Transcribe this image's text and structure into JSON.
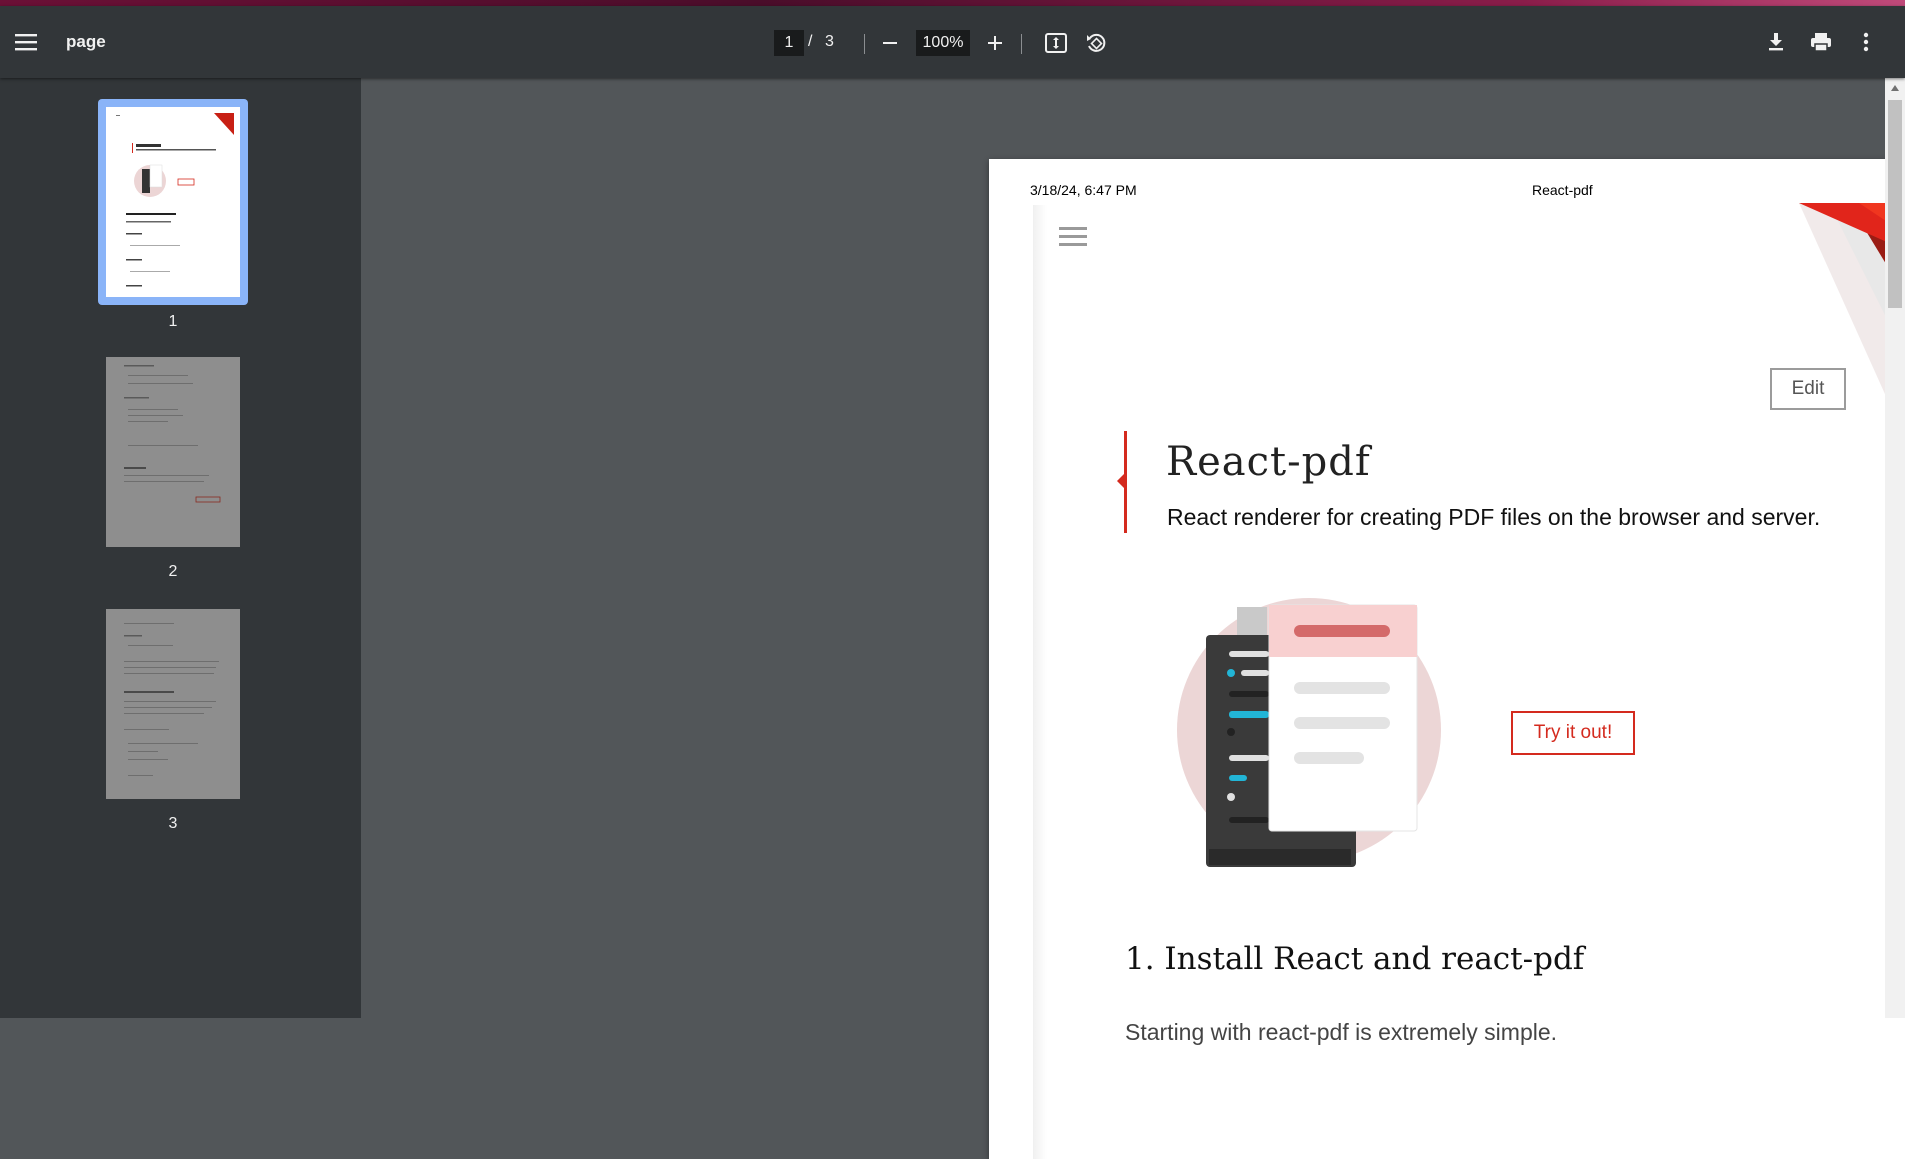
{
  "toolbar": {
    "menu_icon": "hamburger-menu-icon",
    "title": "page",
    "page_current": "1",
    "page_separator": "/",
    "page_total": "3",
    "zoom_value": "100%",
    "zoom_out_icon": "minus-icon",
    "zoom_in_icon": "plus-icon",
    "fit_page_icon": "fit-to-page-icon",
    "rotate_icon": "rotate-counterclockwise-icon",
    "download_icon": "download-icon",
    "print_icon": "print-icon",
    "more_icon": "more-vertical-icon"
  },
  "sidebar": {
    "thumbnails": [
      {
        "number": "1",
        "selected": true
      },
      {
        "number": "2",
        "selected": false
      },
      {
        "number": "3",
        "selected": false
      }
    ]
  },
  "page": {
    "header_date": "3/18/24, 6:47 PM",
    "header_title": "React-pdf",
    "edit_label": "Edit",
    "title": "React-pdf",
    "subtitle": "React renderer for creating PDF files on the browser and server.",
    "try_label": "Try it out!",
    "section_heading": "1. Install React and react-pdf",
    "section_text": "Starting with react-pdf is extremely simple."
  },
  "colors": {
    "accent": "#d42a1e",
    "toolbar_bg": "#323639",
    "viewer_bg": "#525659",
    "thumb_selected": "#8ab4f8"
  }
}
